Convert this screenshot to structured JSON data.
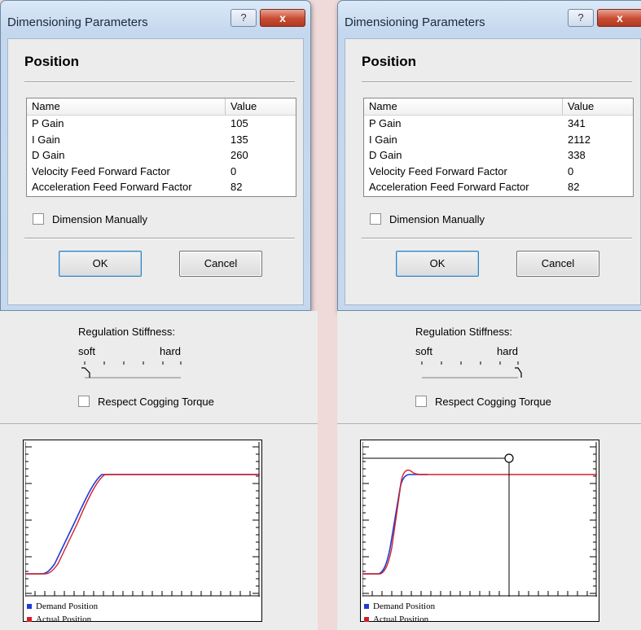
{
  "colors": {
    "demand": "#1f3bd6",
    "actual": "#d2202a",
    "title_text": "#1b2a3c"
  },
  "left": {
    "dialog": {
      "title": "Dimensioning Parameters",
      "help_glyph": "?",
      "close_glyph": "x",
      "heading": "Position",
      "col_name": "Name",
      "col_value": "Value",
      "rows": [
        {
          "name": "P Gain",
          "value": "105"
        },
        {
          "name": "I Gain",
          "value": "135"
        },
        {
          "name": "D Gain",
          "value": "260"
        },
        {
          "name": "Velocity Feed Forward Factor",
          "value": "0"
        },
        {
          "name": "Acceleration Feed Forward Factor",
          "value": "82"
        }
      ],
      "manual_label": "Dimension Manually",
      "ok": "OK",
      "cancel": "Cancel"
    },
    "regulation": {
      "label": "Regulation Stiffness:",
      "soft": "soft",
      "hard": "hard",
      "stiffness_level": 0
    },
    "cogging_label": "Respect Cogging Torque",
    "legend": {
      "demand": "Demand Position",
      "actual": "Actual Position"
    }
  },
  "right": {
    "dialog": {
      "title": "Dimensioning Parameters",
      "help_glyph": "?",
      "close_glyph": "x",
      "heading": "Position",
      "col_name": "Name",
      "col_value": "Value",
      "rows": [
        {
          "name": "P Gain",
          "value": "341"
        },
        {
          "name": "I Gain",
          "value": "2112"
        },
        {
          "name": "D Gain",
          "value": "338"
        },
        {
          "name": "Velocity Feed Forward Factor",
          "value": "0"
        },
        {
          "name": "Acceleration Feed Forward Factor",
          "value": "82"
        }
      ],
      "manual_label": "Dimension Manually",
      "ok": "OK",
      "cancel": "Cancel"
    },
    "regulation": {
      "label": "Regulation Stiffness:",
      "soft": "soft",
      "hard": "hard",
      "stiffness_level": 1
    },
    "cogging_label": "Respect Cogging Torque",
    "legend": {
      "demand": "Demand Position",
      "actual": "Actual Position"
    }
  }
}
